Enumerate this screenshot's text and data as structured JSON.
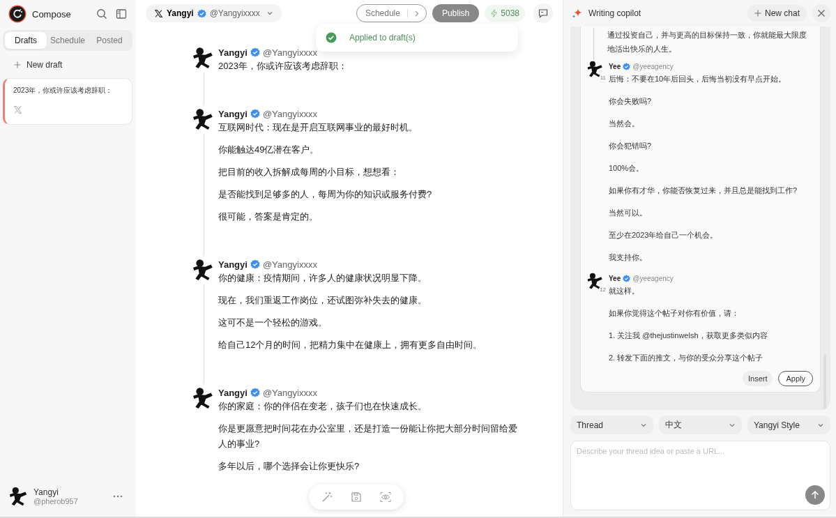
{
  "sidebar": {
    "app_title": "Compose",
    "tabs": [
      {
        "label": "Drafts",
        "selected": true
      },
      {
        "label": "Schedule",
        "selected": false
      },
      {
        "label": "Posted",
        "selected": false
      }
    ],
    "new_draft": "New draft",
    "drafts": [
      {
        "text": "2023年，你或许应该考虑辞职：",
        "selected": true
      }
    ],
    "user": {
      "name": "Yangyi",
      "handle": "@pherob957"
    }
  },
  "toolbar": {
    "account": {
      "name": "Yangyi",
      "handle": "@Yangyixxxx"
    },
    "schedule": "Schedule",
    "publish": "Publish",
    "count": "5038"
  },
  "toast": {
    "text": "Applied to draft(s)"
  },
  "thread": {
    "posts": [
      {
        "name": "Yangyi",
        "handle": "@Yangyixxxx",
        "paragraphs": [
          "2023年，你或许应该考虑辞职："
        ]
      },
      {
        "name": "Yangyi",
        "handle": "@Yangyixxxx",
        "paragraphs": [
          "互联网时代：现在是开启互联网事业的最好时机。",
          "你能触达49亿潜在客户。",
          "把目前的收入拆解成每周的小目标，想想看：",
          "是否能找到足够多的人，每周为你的知识或服务付费?",
          "很可能，答案是肯定的。"
        ]
      },
      {
        "name": "Yangyi",
        "handle": "@Yangyixxxx",
        "paragraphs": [
          "你的健康：疫情期间，许多人的健康状况明显下降。",
          "现在，我们重返工作岗位，还试图弥补失去的健康。",
          "这可不是一个轻松的游戏。",
          "给自己12个月的时间，把精力集中在健康上，拥有更多自由时间。"
        ]
      },
      {
        "name": "Yangyi",
        "handle": "@Yangyixxxx",
        "paragraphs": [
          "你的家庭：你的伴侣在变老，孩子们也在快速成长。",
          "你是更愿意把时间花在办公室里，还是打造一份能让你把大部分时间留给爱人的事业?",
          "多年以后，哪个选择会让你更快乐?"
        ]
      }
    ]
  },
  "copilot": {
    "title": "Writing copilot",
    "new_chat": "New chat",
    "messages": [
      {
        "kind": "continuation",
        "paragraphs": [
          "通过投资自己，并与更高的目标保持一致，你就能最大限度地活出快乐的人生。"
        ]
      },
      {
        "kind": "post",
        "name": "Yee",
        "handle": "@yeeagency",
        "number": "11",
        "paragraphs": [
          "后悔：不要在10年后回头，后悔当初没有早点开始。",
          "你会失败吗?",
          "当然会。",
          "你会犯错吗?",
          "100%会。",
          "如果你有才华，你能否恢复过来，并且总是能找到工作?",
          "当然可以。",
          "至少在2023年给自己一个机会。",
          "我支持你。"
        ]
      },
      {
        "kind": "post",
        "name": "Yee",
        "handle": "@yeeagency",
        "number": "12",
        "paragraphs": [
          "就这样。",
          "如果你觉得这个帖子对你有价值，请：",
          "1. 关注我 @thejustinwelsh，获取更多类似内容",
          "2. 转发下面的推文，与你的受众分享这个帖子"
        ]
      }
    ],
    "actions": {
      "insert": "Insert",
      "apply": "Apply"
    },
    "selects": [
      {
        "value": "Thread"
      },
      {
        "value": "中文"
      },
      {
        "value": "Yangyi Style"
      }
    ],
    "input": {
      "placeholder": "Describe your thread idea or paste a URL..."
    }
  }
}
